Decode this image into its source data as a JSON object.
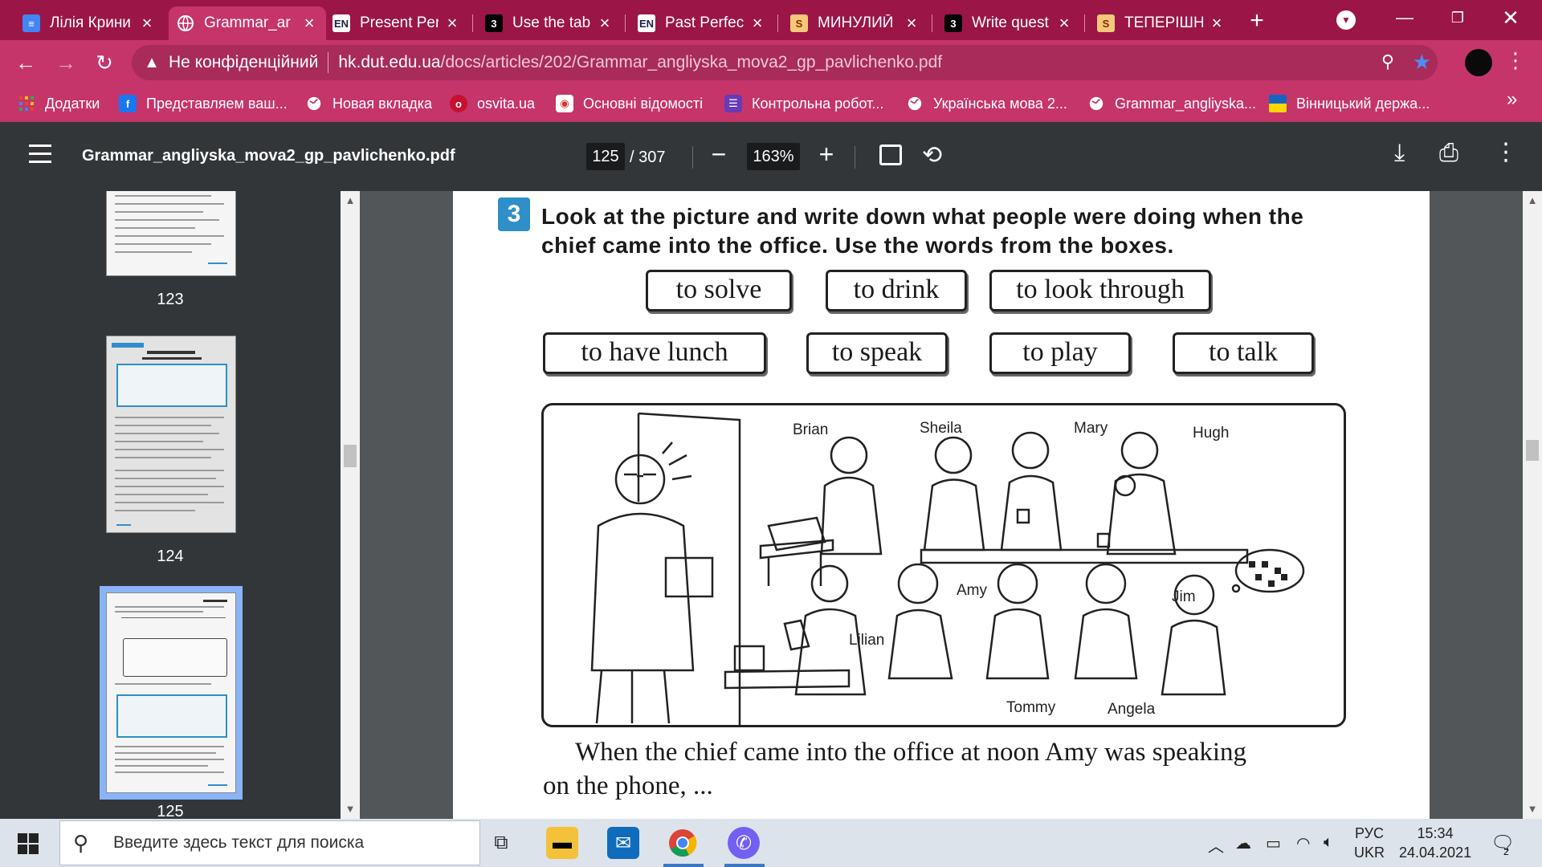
{
  "browser": {
    "tabs": [
      {
        "title": "Лілія Крини",
        "favicon": "docs-icon",
        "fav_color": "#4285f4",
        "fav_text": "",
        "active": false
      },
      {
        "title": "Grammar_ar",
        "favicon": "globe-icon",
        "fav_color": "#ffffff",
        "fav_text": "",
        "active": true
      },
      {
        "title": "Present Perf",
        "favicon": "en-icon",
        "fav_color": "#ffffff",
        "fav_text": "EN",
        "active": false
      },
      {
        "title": "Use the tabl",
        "favicon": "three-icon",
        "fav_color": "#000000",
        "fav_text": "3",
        "active": false
      },
      {
        "title": "Past Perfect",
        "favicon": "en-icon",
        "fav_color": "#ffffff",
        "fav_text": "EN",
        "active": false
      },
      {
        "title": "МИНУЛИЙ",
        "favicon": "s-icon",
        "fav_color": "#f4c87a",
        "fav_text": "S",
        "active": false
      },
      {
        "title": "Write quest",
        "favicon": "three-icon",
        "fav_color": "#000000",
        "fav_text": "3",
        "active": false
      },
      {
        "title": "ТЕПЕРІШНІ",
        "favicon": "s-icon",
        "fav_color": "#f4c87a",
        "fav_text": "S",
        "active": false
      }
    ],
    "omnibox": {
      "security_label": "Не конфіденційний",
      "host": "hk.dut.edu.ua",
      "path": "/docs/articles/202/Grammar_angliyska_mova2_gp_pavlichenko.pdf"
    },
    "bookmarks": [
      {
        "label": "Додатки",
        "icon": "apps-grid-icon",
        "color": "#ea4335"
      },
      {
        "label": "Представляем ваш...",
        "icon": "facebook-icon",
        "color": "#1877f2"
      },
      {
        "label": "Новая вкладка",
        "icon": "globe-icon",
        "color": "#ffffff"
      },
      {
        "label": "osvita.ua",
        "icon": "osvita-icon",
        "color": "#c8102e"
      },
      {
        "label": "Основні відомості",
        "icon": "site-icon",
        "color": "#d32f2f"
      },
      {
        "label": "Контрольна робот...",
        "icon": "forms-icon",
        "color": "#673ab7"
      },
      {
        "label": "Українська мова 2...",
        "icon": "globe-icon",
        "color": "#ffffff"
      },
      {
        "label": "Grammar_angliyska...",
        "icon": "globe-icon",
        "color": "#ffffff"
      },
      {
        "label": "Вінницький держа...",
        "icon": "ua-flag-icon",
        "color": "#ffd700"
      }
    ],
    "bookmarks_more": "»"
  },
  "pdf": {
    "filename": "Grammar_angliyska_mova2_gp_pavlichenko.pdf",
    "page_current": "125",
    "page_total": "/ 307",
    "zoom": "163%",
    "thumbnails": [
      {
        "number": "123"
      },
      {
        "number": "124"
      },
      {
        "number": "125",
        "selected": true
      }
    ],
    "content": {
      "exercise_number": "3",
      "instruction": "Look at the picture and write down what people were doing when the chief came into the office. Use the words from the boxes.",
      "word_boxes_row1": [
        "to solve",
        "to drink",
        "to look through"
      ],
      "word_boxes_row2": [
        "to have lunch",
        "to speak",
        "to play",
        "to talk"
      ],
      "people": [
        "Brian",
        "Sheila",
        "Mary",
        "Hugh",
        "Lilian",
        "Amy",
        "Tommy",
        "Angela",
        "Jim"
      ],
      "answer_line1": "When the chief came into the office at noon Amy was speaking",
      "answer_line2": "on the phone, ..."
    }
  },
  "taskbar": {
    "search_placeholder": "Введите здесь текст для поиска",
    "lang_top": "РУС",
    "lang_bottom": "UKR",
    "time": "15:34",
    "date": "24.04.2021",
    "notification_count": "2"
  }
}
